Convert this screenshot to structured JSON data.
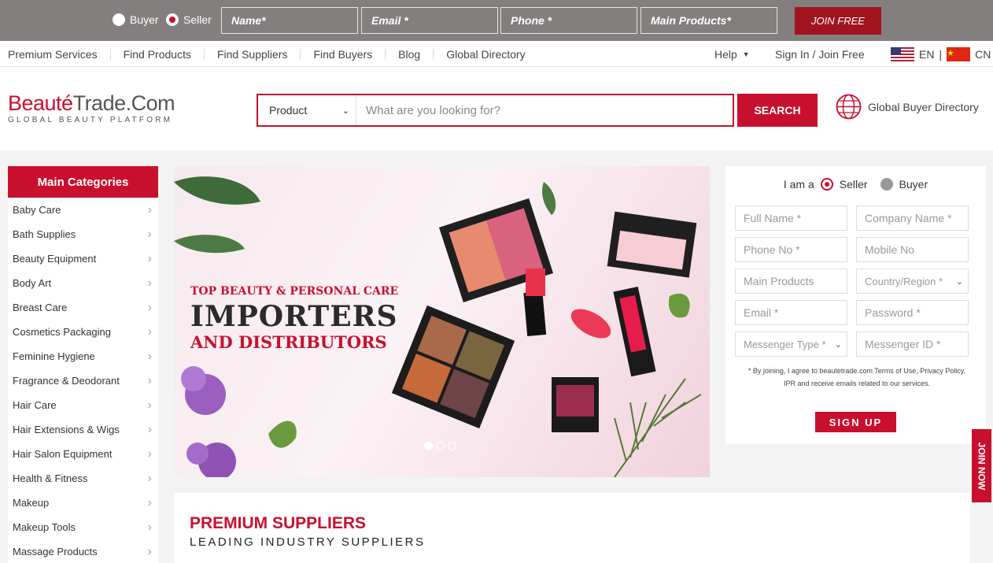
{
  "topbar": {
    "buyer_label": "Buyer",
    "seller_label": "Seller",
    "selected_role": "Seller",
    "placeholders": [
      "Name*",
      "Email *",
      "Phone *",
      "Main Products*"
    ],
    "join_label": "JOIN FREE"
  },
  "nav": {
    "items": [
      "Premium Services",
      "Find Products",
      "Find Suppliers",
      "Find Buyers",
      "Blog",
      "Global Directory"
    ],
    "help": "Help",
    "signin": "Sign In / Join Free",
    "lang_en": "EN",
    "lang_sep": "|",
    "lang_cn": "CN"
  },
  "header": {
    "logo_part1": "Beauté",
    "logo_part2": "Trade.Com",
    "logo_tagline": "GLOBAL BEAUTY PLATFORM",
    "search_category": "Product",
    "search_placeholder": "What are you looking for?",
    "search_button": "SEARCH",
    "global_buyer_directory": "Global Buyer Directory"
  },
  "categories": {
    "title": "Main Categories",
    "items": [
      "Baby Care",
      "Bath Supplies",
      "Beauty Equipment",
      "Body Art",
      "Breast Care",
      "Cosmetics Packaging",
      "Feminine Hygiene",
      "Fragrance & Deodorant",
      "Hair Care",
      "Hair Extensions & Wigs",
      "Hair Salon Equipment",
      "Health & Fitness",
      "Makeup",
      "Makeup Tools",
      "Massage Products"
    ]
  },
  "banner": {
    "kicker": "TOP BEAUTY & PERSONAL CARE",
    "title": "IMPORTERS",
    "subtitle": "AND DISTRIBUTORS",
    "active_slide": 1,
    "slide_count": 3
  },
  "signup": {
    "iam": "I am a",
    "seller": "Seller",
    "buyer": "Buyer",
    "selected_role": "Seller",
    "fields": {
      "full_name": "Full Name *",
      "company_name": "Company Name *",
      "phone": "Phone No *",
      "mobile": "Mobile No",
      "main_products": "Main Products",
      "country": "Country/Region *",
      "email": "Email *",
      "password": "Password *",
      "messenger_type": "Messenger Type *",
      "messenger_id": "Messenger ID *"
    },
    "terms": "* By joining, I agree to beautetrade.com Terms of Use, Privacy Policy, IPR and receive emails related to our services.",
    "button": "SIGN UP"
  },
  "join_now": "JOIN NOW",
  "premium": {
    "title": "PREMIUM SUPPLIERS",
    "subtitle": "LEADING INDUSTRY SUPPLIERS"
  },
  "colors": {
    "brand_red": "#c8102e",
    "topbar_gray": "#827f7e"
  }
}
